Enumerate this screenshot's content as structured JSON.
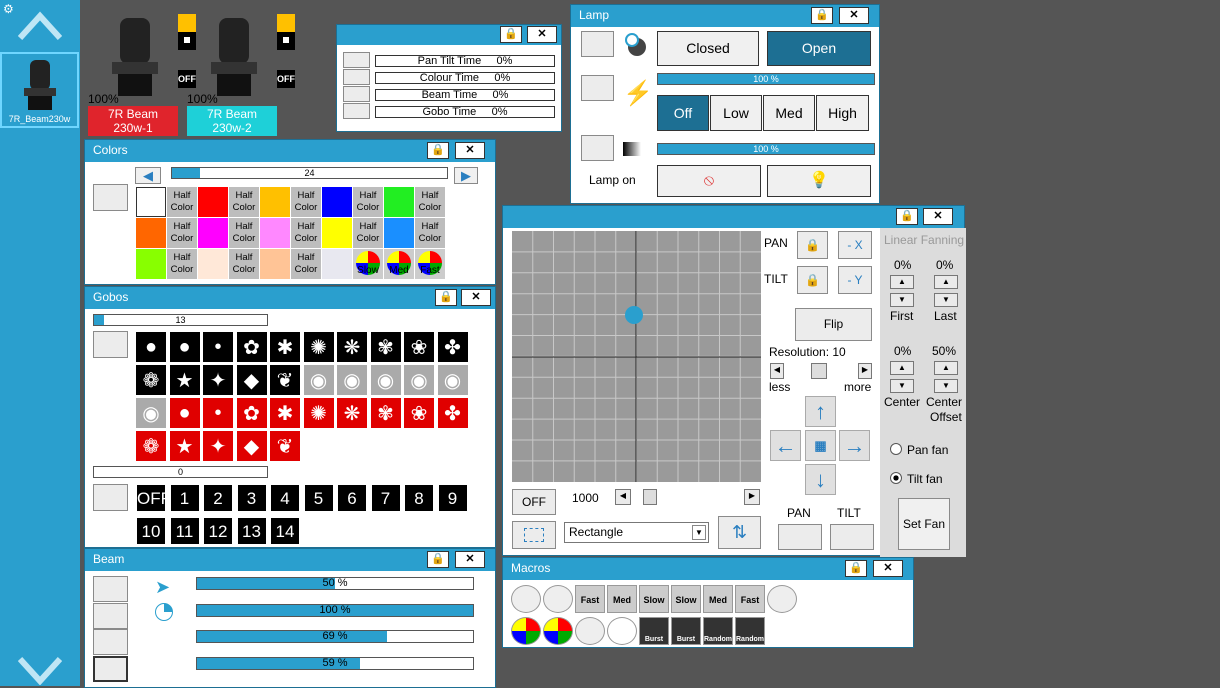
{
  "sidebar": {
    "fixture_label": "7R_Beam230w"
  },
  "fixtures": [
    {
      "name": "7R Beam 230w-1",
      "line1": "7R Beam",
      "line2": "230w-1",
      "intensity": "100%",
      "color": "#e0242c",
      "sign": "OFF"
    },
    {
      "name": "7R Beam 230w-2",
      "line1": "7R Beam",
      "line2": "230w-2",
      "intensity": "100%",
      "color": "#1ed0d8",
      "sign": "OFF"
    }
  ],
  "timings": {
    "rows": [
      {
        "label": "Pan Tilt Time",
        "value": "0%"
      },
      {
        "label": "Colour Time",
        "value": "0%"
      },
      {
        "label": "Beam Time",
        "value": "0%"
      },
      {
        "label": "Gobo Time",
        "value": "0%"
      }
    ]
  },
  "lamp": {
    "title": "Lamp",
    "closed": "Closed",
    "open": "Open",
    "slider1": "100 %",
    "off": "Off",
    "low": "Low",
    "med": "Med",
    "high": "High",
    "slider2": "100 %",
    "lamp_on": "Lamp on"
  },
  "colors": {
    "title": "Colors",
    "slider": "24",
    "half": "Half",
    "color": "Color",
    "slow": "Slow",
    "med": "Med",
    "fast": "Fast",
    "row1": [
      "#ffffff",
      "half",
      "#ff0000",
      "half",
      "#ffc000",
      "half",
      "#0000ff",
      "half",
      "#22ee22",
      "half"
    ],
    "row2": [
      "#ff6600",
      "half",
      "#ff00ff",
      "half",
      "#ff88ff",
      "half",
      "#ffff00",
      "half",
      "#1a8fff",
      "half"
    ],
    "row3": [
      "#88ff00",
      "half",
      "#ffe8d8",
      "half",
      "#ffc496",
      "half",
      "#e8e8f0",
      "wheel-slow",
      "wheel-med",
      "wheel-fast"
    ]
  },
  "gobos": {
    "title": "Gobos",
    "slider1": "13",
    "slider2": "0",
    "numbers": [
      "OFF",
      "1",
      "2",
      "3",
      "4",
      "5",
      "6",
      "7",
      "8",
      "9",
      "10",
      "11",
      "12",
      "13",
      "14"
    ]
  },
  "beam": {
    "title": "Beam",
    "sliders": [
      {
        "label": "50 %",
        "value": 0.5
      },
      {
        "label": "100 %",
        "value": 1.0
      },
      {
        "label": "69 %",
        "value": 0.69
      },
      {
        "label": "59 %",
        "value": 0.59
      }
    ]
  },
  "position": {
    "pan": "PAN",
    "tilt": "TILT",
    "minus_x": "- X",
    "minus_y": "- Y",
    "flip": "Flip",
    "resolution": "Resolution: 10",
    "less": "less",
    "more": "more",
    "off": "OFF",
    "speed": "1000",
    "shape": "Rectangle",
    "pan_label": "PAN",
    "tilt_label": "TILT",
    "fan": {
      "title": "Linear Fanning",
      "first_val": "0%",
      "last_val": "0%",
      "first": "First",
      "last": "Last",
      "center_val": "0%",
      "offset_val": "50%",
      "center": "Center",
      "center2": "Center",
      "offset": "Offset",
      "pan_fan": "Pan fan",
      "tilt_fan": "Tilt fan",
      "set_fan": "Set Fan"
    }
  },
  "macros": {
    "title": "Macros",
    "row1": [
      "",
      "",
      "Fast",
      "Med",
      "Slow",
      "Slow",
      "Med",
      "Fast",
      ""
    ],
    "row2": [
      "",
      "",
      "",
      "",
      "Burst",
      "Burst",
      "Random",
      "Random"
    ]
  },
  "accent": "#2a9fce"
}
